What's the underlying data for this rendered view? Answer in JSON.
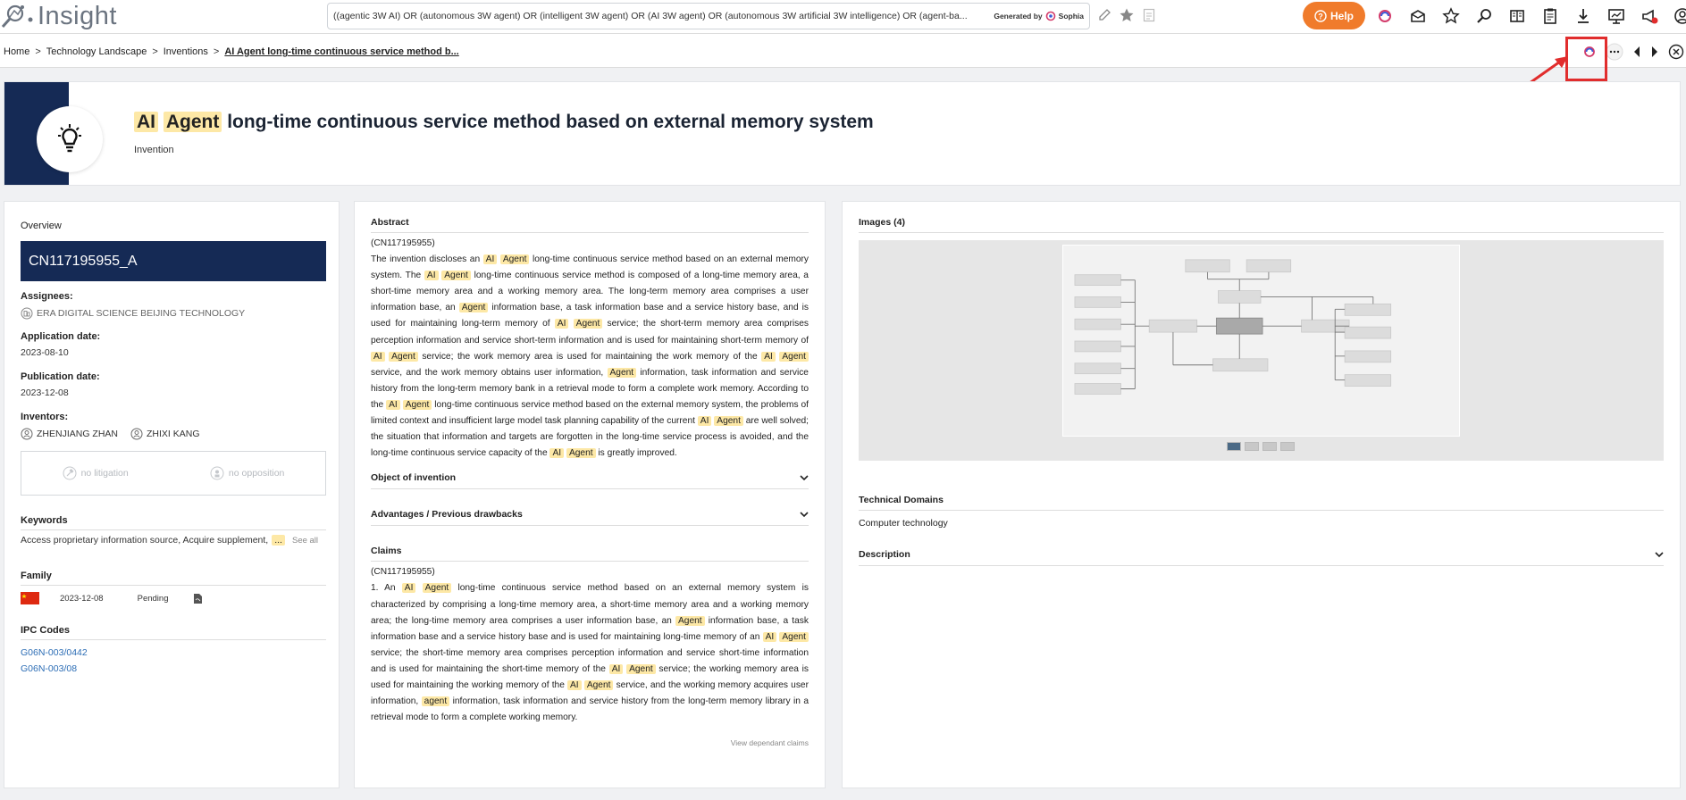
{
  "app": {
    "name": "Insight"
  },
  "search": {
    "query": "((agentic 3W AI) OR (autonomous 3W agent) OR (intelligent 3W agent) OR (AI 3W agent) OR (autonomous 3W artificial 3W intelligence) OR (agent-ba...",
    "generated_label": "Generated by",
    "generator": "Sophia"
  },
  "help": {
    "label": "Help"
  },
  "breadcrumb": {
    "home": "Home",
    "landscape": "Technology Landscape",
    "inventions": "Inventions",
    "current": "AI Agent long-time continuous service method b..."
  },
  "header": {
    "title_hl1": "AI",
    "title_hl2": "Agent",
    "title_rest": "long-time continuous service method based on external memory system",
    "subtitle": "Invention"
  },
  "overview": {
    "label": "Overview",
    "patent_id": "CN117195955_A",
    "assignees_label": "Assignees:",
    "assignee": "ERA DIGITAL SCIENCE BEIJING TECHNOLOGY",
    "application_label": "Application date:",
    "application_date": "2023-08-10",
    "publication_label": "Publication date:",
    "publication_date": "2023-12-08",
    "inventors_label": "Inventors:",
    "inventor1": "ZHENJIANG ZHAN",
    "inventor2": "ZHIXI KANG",
    "no_litigation": "no litigation",
    "no_opposition": "no opposition",
    "keywords_label": "Keywords",
    "keywords": "Access proprietary information source, Acquire supplement,",
    "keywords_more": "...",
    "see_all": "See all",
    "family_label": "Family",
    "family_date": "2023-12-08",
    "family_status": "Pending",
    "ipc_label": "IPC Codes",
    "ipc1": "G06N-003/0442",
    "ipc2": "G06N-003/08"
  },
  "abstract": {
    "label": "Abstract",
    "ref": "(CN117195955)"
  },
  "object": {
    "label": "Object of invention"
  },
  "advantages": {
    "label": "Advantages / Previous drawbacks"
  },
  "claims": {
    "label": "Claims",
    "ref": "(CN117195955)",
    "view_dependant": "View dependant claims"
  },
  "images": {
    "label": "Images (4)",
    "pages": [
      "1",
      "2",
      "3",
      "4"
    ]
  },
  "technical_domains": {
    "label": "Technical Domains",
    "value": "Computer technology"
  },
  "description": {
    "label": "Description"
  },
  "colors": {
    "navy": "#152a55",
    "highlight": "#fde8a6",
    "help_orange": "#f07b2b",
    "red_box": "#e12d2d",
    "link_blue": "#2c6db5"
  }
}
